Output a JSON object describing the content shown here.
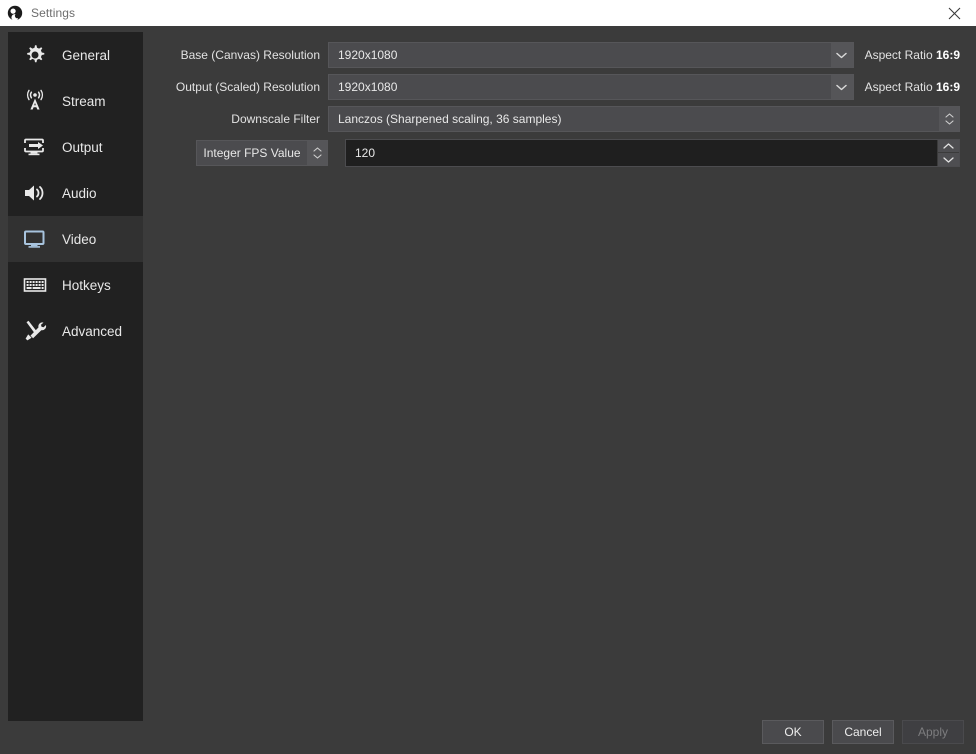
{
  "titlebar": {
    "title": "Settings",
    "app_icon": "obs-logo-icon",
    "close_icon": "close-icon"
  },
  "sidebar": {
    "items": [
      {
        "id": "general",
        "label": "General",
        "icon": "gear-icon",
        "selected": false
      },
      {
        "id": "stream",
        "label": "Stream",
        "icon": "antenna-icon",
        "selected": false
      },
      {
        "id": "output",
        "label": "Output",
        "icon": "monitor-arrow-icon",
        "selected": false
      },
      {
        "id": "audio",
        "label": "Audio",
        "icon": "speaker-icon",
        "selected": false
      },
      {
        "id": "video",
        "label": "Video",
        "icon": "monitor-icon",
        "selected": true
      },
      {
        "id": "hotkeys",
        "label": "Hotkeys",
        "icon": "keyboard-icon",
        "selected": false
      },
      {
        "id": "advanced",
        "label": "Advanced",
        "icon": "tools-icon",
        "selected": false
      }
    ]
  },
  "video": {
    "base_resolution": {
      "label": "Base (Canvas) Resolution",
      "value": "1920x1080",
      "aspect_prefix": "Aspect Ratio",
      "aspect_value": "16:9"
    },
    "output_resolution": {
      "label": "Output (Scaled) Resolution",
      "value": "1920x1080",
      "aspect_prefix": "Aspect Ratio",
      "aspect_value": "16:9"
    },
    "downscale_filter": {
      "label": "Downscale Filter",
      "value": "Lanczos (Sharpened scaling, 36 samples)"
    },
    "fps": {
      "type_label": "Integer FPS Value",
      "value": "120"
    }
  },
  "footer": {
    "ok_label": "OK",
    "cancel_label": "Cancel",
    "apply_label": "Apply",
    "apply_disabled": true
  },
  "colors": {
    "window_bg": "#3b3b3b",
    "sidebar_bg": "#212121",
    "sidebar_selected_bg": "#313131",
    "field_bg": "#4b4b4e",
    "input_bg": "#1f1f1f",
    "text": "#e8e8e8",
    "accent_icon": "#a8c4de"
  }
}
